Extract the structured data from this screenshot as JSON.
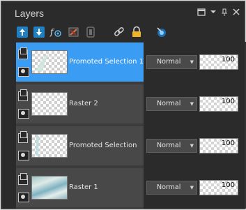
{
  "panel": {
    "title": "Layers",
    "controls": [
      "window-icon",
      "dropdown-icon",
      "pin-icon",
      "close-icon"
    ]
  },
  "toolbar": {
    "tools": [
      {
        "icon": "new-raster-layer-icon",
        "color": "#3fb0e6"
      },
      {
        "icon": "new-vector-layer-icon",
        "color": "#3fb0e6"
      },
      {
        "icon": "visibility-toggle-icon",
        "color": "#cfcfcf"
      },
      {
        "icon": "mask-icon",
        "color": "#e07a3a"
      },
      {
        "icon": "group-icon",
        "color": "#707070"
      },
      {
        "icon": "link-icon",
        "color": "#c9c9c9"
      },
      {
        "icon": "lock-icon",
        "color": "#f0b429"
      },
      {
        "icon": "view-options-icon",
        "color": "#5ab4f0"
      }
    ]
  },
  "layers": [
    {
      "name": "Promoted Selection 1",
      "blend_mode": "Normal",
      "opacity": "100",
      "selected": true
    },
    {
      "name": "Raster 2",
      "blend_mode": "Normal",
      "opacity": "100",
      "selected": false
    },
    {
      "name": "Promoted Selection",
      "blend_mode": "Normal",
      "opacity": "100",
      "selected": false
    },
    {
      "name": "Raster 1",
      "blend_mode": "Normal",
      "opacity": "100",
      "selected": false
    }
  ]
}
